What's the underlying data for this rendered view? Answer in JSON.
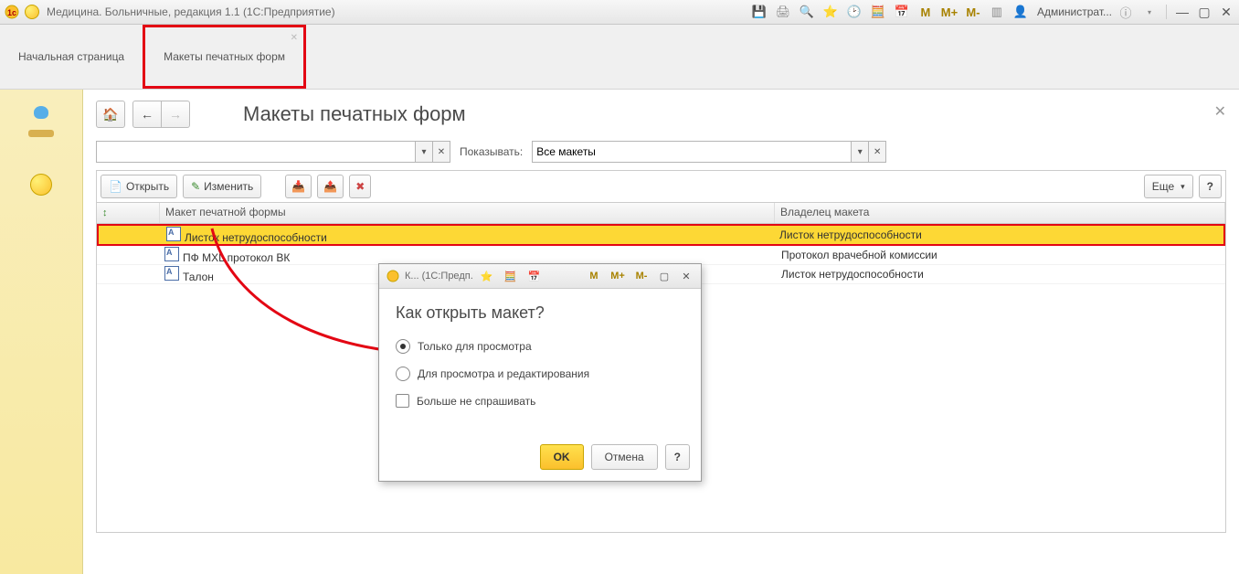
{
  "titlebar": {
    "app_title": "Медицина. Больничные, редакция 1.1  (1С:Предприятие)",
    "user_label": "Администрат...",
    "m_btn": "M",
    "mplus_btn": "M+",
    "mminus_btn": "M-"
  },
  "tabs": {
    "home": "Начальная страница",
    "active": "Макеты печатных форм"
  },
  "page": {
    "title": "Макеты печатных форм",
    "filter_show_label": "Показывать:",
    "filter_show_value": "Все макеты",
    "more_btn": "Еще",
    "help_btn": "?"
  },
  "toolbar": {
    "open": "Открыть",
    "edit": "Изменить"
  },
  "table": {
    "col_template": "Макет печатной формы",
    "col_owner": "Владелец макета",
    "rows": [
      {
        "name": "Листок нетрудоспособности",
        "owner": "Листок нетрудоспособности"
      },
      {
        "name": "ПФ MXL протокол ВК",
        "owner": "Протокол врачебной комиссии"
      },
      {
        "name": "Талон",
        "owner": "Листок нетрудоспособности"
      }
    ]
  },
  "dialog": {
    "window_title": "К...  (1С:Предп.",
    "heading": "Как открыть макет?",
    "opt_view": "Только для просмотра",
    "opt_edit": "Для просмотра и редактирования",
    "dont_ask": "Больше не спрашивать",
    "ok": "OK",
    "cancel": "Отмена",
    "help": "?",
    "m_btn": "M",
    "mplus_btn": "M+",
    "mminus_btn": "M-"
  }
}
